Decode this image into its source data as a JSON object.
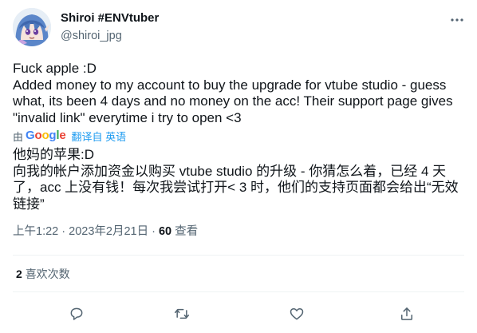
{
  "author": {
    "display_name": "Shiroi #ENVtuber",
    "handle": "@shiroi_jpg",
    "avatar_icon": "anime-avatar"
  },
  "tweet": {
    "text": "Fuck apple :D\nAdded money to my account to buy the upgrade for vtube studio - guess what, its been 4 days and no money on the acc! Their support page gives \"invalid link\" everytime i try to open <3"
  },
  "translation": {
    "prefix": "由",
    "provider": "Google",
    "link_label": "翻译自 英语",
    "text": "他妈的苹果:D\n向我的帐户添加资金以购买 vtube studio 的升级 - 你猜怎么着，已经 4 天了，acc 上没有钱！每次我尝试打开< 3 时，他们的支持页面都会给出“无效链接”"
  },
  "meta": {
    "time": "上午1:22",
    "separator": " · ",
    "date": "2023年2月21日",
    "views_count": "60",
    "views_label": "查看"
  },
  "engagement": {
    "likes_count": "2",
    "likes_label": "喜欢次数"
  },
  "colors": {
    "text": "#0f1419",
    "secondary": "#536471",
    "link": "#1d9bf0",
    "divider": "#eff3f4"
  }
}
